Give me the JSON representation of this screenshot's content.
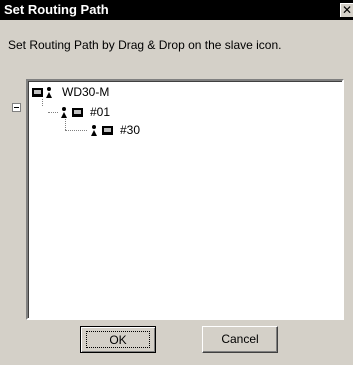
{
  "window": {
    "title": "Set Routing Path",
    "close_glyph": "✕"
  },
  "instruction": "Set Routing Path by Drag & Drop on the slave icon.",
  "tree": {
    "root": {
      "label": "WD30-M",
      "icon": "master-device-icon"
    },
    "child": {
      "label": "#01",
      "icon": "slave-device-icon",
      "expanded": true
    },
    "grandchild": {
      "label": "#30",
      "icon": "slave-device-icon"
    }
  },
  "buttons": {
    "ok_label": "OK",
    "cancel_label": "Cancel"
  }
}
